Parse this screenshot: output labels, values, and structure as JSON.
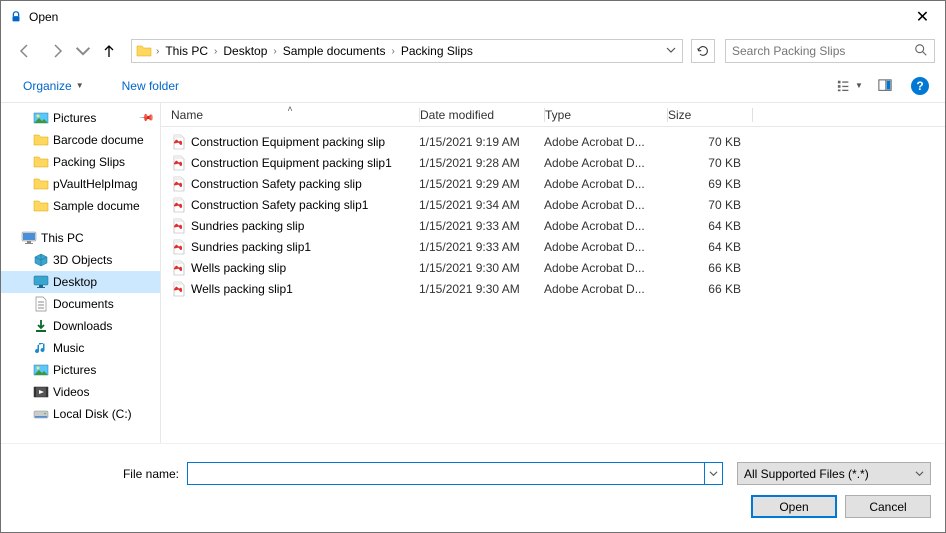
{
  "window": {
    "title": "Open"
  },
  "breadcrumb": {
    "items": [
      "This PC",
      "Desktop",
      "Sample documents",
      "Packing Slips"
    ]
  },
  "search": {
    "placeholder": "Search Packing Slips"
  },
  "toolbar": {
    "organize": "Organize",
    "new_folder": "New folder"
  },
  "sidebar": {
    "quick": [
      {
        "label": "Pictures",
        "icon": "pictures",
        "pinned": true
      },
      {
        "label": "Barcode docume",
        "icon": "folder"
      },
      {
        "label": "Packing Slips",
        "icon": "folder"
      },
      {
        "label": "pVaultHelpImag",
        "icon": "folder"
      },
      {
        "label": "Sample docume",
        "icon": "folder"
      }
    ],
    "thispc_label": "This PC",
    "thispc": [
      {
        "label": "3D Objects",
        "icon": "3d"
      },
      {
        "label": "Desktop",
        "icon": "desktop",
        "selected": true
      },
      {
        "label": "Documents",
        "icon": "documents"
      },
      {
        "label": "Downloads",
        "icon": "downloads"
      },
      {
        "label": "Music",
        "icon": "music"
      },
      {
        "label": "Pictures",
        "icon": "pictures"
      },
      {
        "label": "Videos",
        "icon": "videos"
      },
      {
        "label": "Local Disk (C:)",
        "icon": "disk"
      }
    ]
  },
  "columns": {
    "name": "Name",
    "date": "Date modified",
    "type": "Type",
    "size": "Size"
  },
  "files": [
    {
      "name": "Construction Equipment packing slip",
      "date": "1/15/2021 9:19 AM",
      "type": "Adobe Acrobat D...",
      "size": "70 KB"
    },
    {
      "name": "Construction Equipment packing slip1",
      "date": "1/15/2021 9:28 AM",
      "type": "Adobe Acrobat D...",
      "size": "70 KB"
    },
    {
      "name": "Construction Safety packing slip",
      "date": "1/15/2021 9:29 AM",
      "type": "Adobe Acrobat D...",
      "size": "69 KB"
    },
    {
      "name": "Construction Safety packing slip1",
      "date": "1/15/2021 9:34 AM",
      "type": "Adobe Acrobat D...",
      "size": "70 KB"
    },
    {
      "name": "Sundries packing slip",
      "date": "1/15/2021 9:33 AM",
      "type": "Adobe Acrobat D...",
      "size": "64 KB"
    },
    {
      "name": "Sundries packing slip1",
      "date": "1/15/2021 9:33 AM",
      "type": "Adobe Acrobat D...",
      "size": "64 KB"
    },
    {
      "name": "Wells packing slip",
      "date": "1/15/2021 9:30 AM",
      "type": "Adobe Acrobat D...",
      "size": "66 KB"
    },
    {
      "name": "Wells packing slip1",
      "date": "1/15/2021 9:30 AM",
      "type": "Adobe Acrobat D...",
      "size": "66 KB"
    }
  ],
  "footer": {
    "filename_label": "File name:",
    "filename_value": "",
    "filetype": "All Supported Files (*.*)",
    "open": "Open",
    "cancel": "Cancel"
  }
}
